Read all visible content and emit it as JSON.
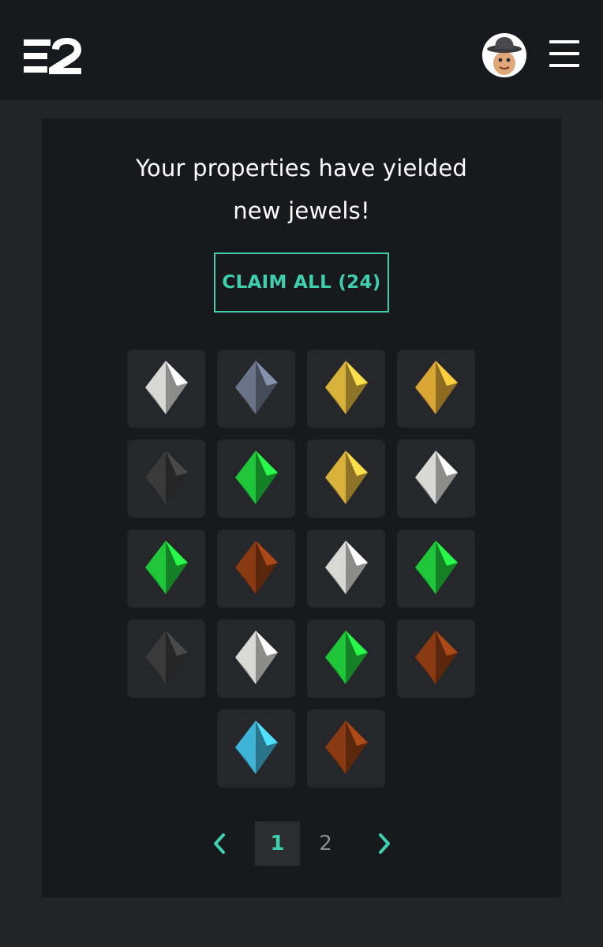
{
  "header": {
    "logo_alt": "E2",
    "colors": {
      "bar": "#18191c",
      "accent": "#3ecfae"
    },
    "avatar_icon": "cowboy-avatar-icon",
    "menu_icon": "hamburger-menu-icon"
  },
  "main": {
    "headline": "Your properties have yielded new jewels!",
    "claim_button": "CLAIM ALL (24)",
    "jewels": [
      {
        "type": "white",
        "color": "#d8d8d6"
      },
      {
        "type": "slate",
        "color": "#6a7388"
      },
      {
        "type": "gold",
        "color": "#d9b23c"
      },
      {
        "type": "gold",
        "color": "#d9a533"
      },
      {
        "type": "black",
        "color": "#3a3a3a"
      },
      {
        "type": "green",
        "color": "#1fc63a"
      },
      {
        "type": "gold",
        "color": "#d9b23c"
      },
      {
        "type": "white",
        "color": "#d8d8d6"
      },
      {
        "type": "green",
        "color": "#1fc63a"
      },
      {
        "type": "amber",
        "color": "#8a3a12"
      },
      {
        "type": "white",
        "color": "#d8d8d6"
      },
      {
        "type": "green",
        "color": "#1fc63a"
      },
      {
        "type": "black",
        "color": "#3a3a3a"
      },
      {
        "type": "white",
        "color": "#d8d8d6"
      },
      {
        "type": "green",
        "color": "#1fc63a"
      },
      {
        "type": "amber",
        "color": "#8a3a12"
      },
      {
        "type": "cyan",
        "color": "#3fb3d6"
      },
      {
        "type": "amber",
        "color": "#8a3a12"
      }
    ]
  },
  "pagination": {
    "prev_icon": "chevron-left-icon",
    "next_icon": "chevron-right-icon",
    "pages": [
      "1",
      "2"
    ],
    "current": "1"
  }
}
